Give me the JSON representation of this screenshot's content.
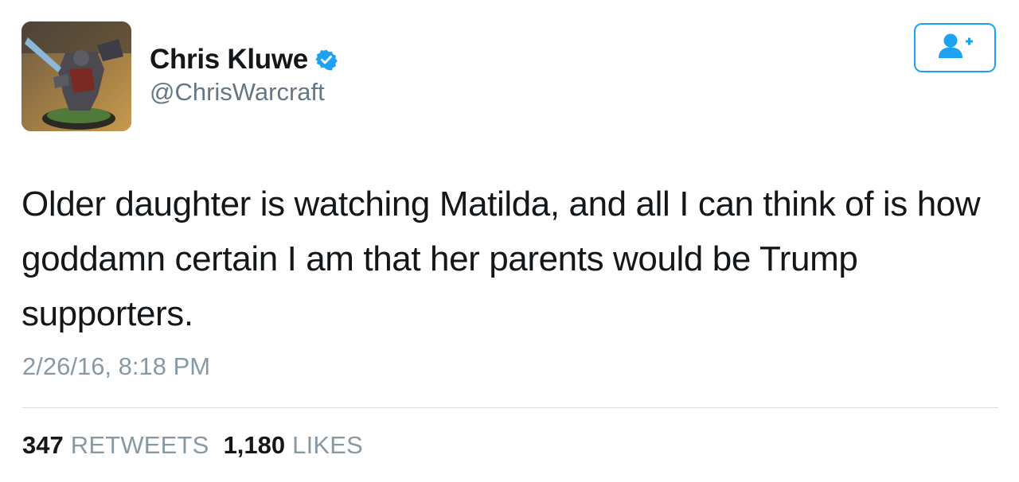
{
  "profile": {
    "display_name": "Chris Kluwe",
    "handle": "@ChrisWarcraft",
    "verified": true
  },
  "follow_button": {
    "icon": "follow-user-plus-icon"
  },
  "tweet": {
    "text": "Older daughter is watching Matilda, and all I can think of is how goddamn certain I am that her parents would be Trump supporters.",
    "timestamp": "2/26/16, 8:18 PM"
  },
  "stats": {
    "retweets_count": "347",
    "retweets_label": "RETWEETS",
    "likes_count": "1,180",
    "likes_label": "LIKES"
  },
  "colors": {
    "accent": "#1da1f2",
    "verified_badge": "#1da1f2",
    "secondary_text": "#657786",
    "muted_text": "#8899a6"
  }
}
